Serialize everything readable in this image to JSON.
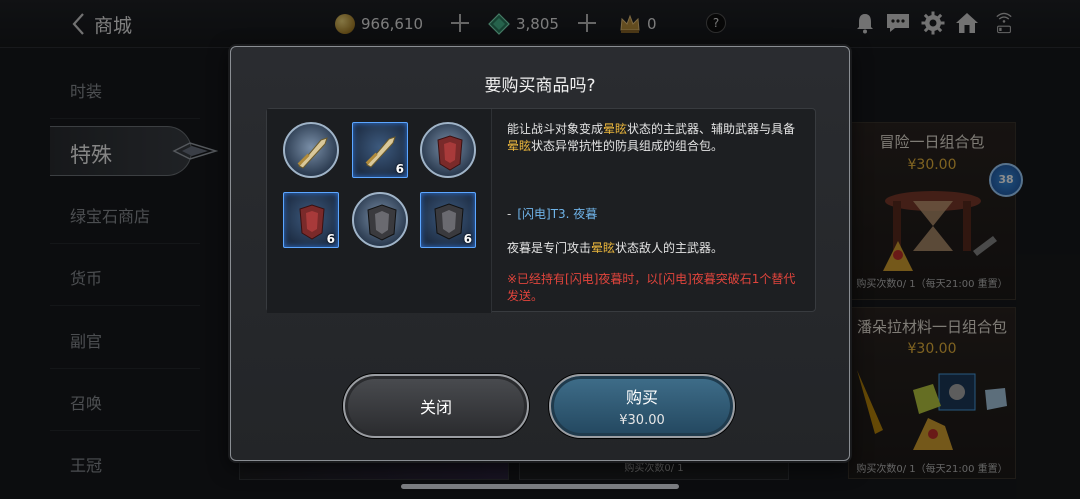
{
  "header": {
    "title": "商城",
    "gold": "966,610",
    "gems": "3,805",
    "crowns": "0",
    "help": "?"
  },
  "sidebar": {
    "items": [
      {
        "label": "时装"
      },
      {
        "label": "特殊"
      },
      {
        "label": "绿宝石商店"
      },
      {
        "label": "货币"
      },
      {
        "label": "副官"
      },
      {
        "label": "召唤"
      },
      {
        "label": "王冠"
      }
    ],
    "active_index": 1
  },
  "cards": [
    {
      "title": "冒险一日组合包",
      "price": "¥30.00",
      "limit": "购买次数0/ 1（每天21:00 重置）",
      "badge": "38"
    },
    {
      "title": "潘朵拉材料一日组合包",
      "price": "¥30.00",
      "limit": "购买次数0/ 1（每天21:00 重置）"
    },
    {
      "limit": "购买次数0/ 1"
    }
  ],
  "modal": {
    "title": "要购买商品吗?",
    "items": [
      {
        "name": "weapon-round",
        "count": ""
      },
      {
        "name": "weapon-square",
        "count": "6"
      },
      {
        "name": "armor-red-round",
        "count": ""
      },
      {
        "name": "armor-red-square",
        "count": "6"
      },
      {
        "name": "armor-dark-round",
        "count": ""
      },
      {
        "name": "armor-dark-square",
        "count": "6"
      }
    ],
    "desc_parts": [
      "能让战斗对象变成",
      "晕眩",
      "状态的主武器、辅助武器与具备",
      "晕眩",
      "状态异常抗性的防具组成的组合包。"
    ],
    "link_dash": "-",
    "link_text": "[闪电]T3. 夜暮",
    "desc2_parts": [
      "夜暮是专门攻击",
      "晕眩",
      "状态敌人的主武器。"
    ],
    "warning": "※已经持有[闪电]夜暮时，以[闪电]夜暮突破石1个替代发送。",
    "close_label": "关闭",
    "buy_label": "购买",
    "buy_price": "¥30.00"
  },
  "colors": {
    "accent_gold": "#e8b43c",
    "link_blue": "#6fb3e8",
    "warning_red": "#e0443c"
  }
}
